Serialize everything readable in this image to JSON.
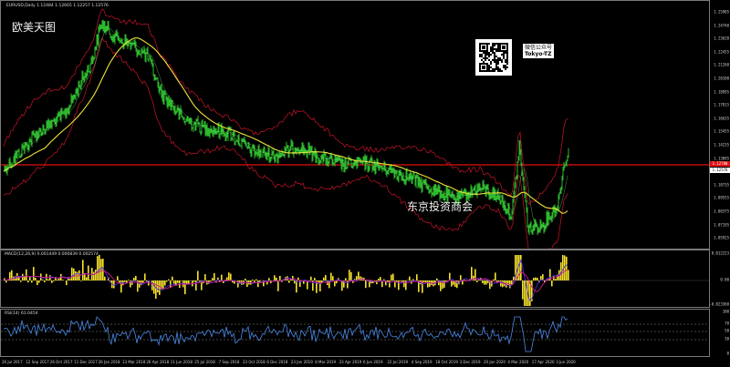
{
  "colors": {
    "background": "#000000",
    "price": "#2eb82e",
    "ma_yellow": "#f0e23a",
    "band_red": "#c8142a",
    "hline": "#e01010",
    "macd_hist": "#f7e22a",
    "macd_line1": "#4a2ad8",
    "macd_line2": "#d01a8a",
    "rsi": "#4a8be8",
    "grid": "#444444"
  },
  "header": {
    "symbol_info": "EURUSD,Daily  1.12484 1.12665 1.12257 1.12576"
  },
  "watermarks": {
    "top_left": "欧美天图",
    "center": "东京投资商会",
    "qr_caption_line1": "微信公众号",
    "qr_caption_line2": "Tokyo-TZ"
  },
  "price_axis": {
    "ticks": [
      "1.25905",
      "1.24740",
      "1.23620",
      "1.22455",
      "1.21260",
      "1.20180",
      "1.18995",
      "1.17815",
      "1.16635",
      "1.15455",
      "1.14235",
      "1.13095",
      "1.11915",
      "1.10735",
      "1.09555",
      "1.08375",
      "1.07195",
      "1.05925"
    ],
    "current_price": "1.12576",
    "hline_price": "1.12780"
  },
  "macd": {
    "label": "MACD(12,26,9) 0.001449 0.000839 0.002574",
    "ticks": [
      "0.012223",
      "0.00",
      "-0.023360"
    ]
  },
  "rsi": {
    "label": "RSI(14) 61.0454",
    "ticks": [
      "100",
      "70",
      "50",
      "30",
      "0"
    ]
  },
  "time_axis": {
    "labels": [
      "26 Jul 2017",
      "12 Sep 2017",
      "26 Oct 2017",
      "11 Dec 2017",
      "26 Jan 2018",
      "13 Mar 2018",
      "26 Apr 2018",
      "11 Jun 2018",
      "25 Jul 2018",
      "7 Sep 2018",
      "23 Oct 2018",
      "6 Dec 2018",
      "23 Jan 2019",
      "8 Mar 2019",
      "23 Apr 2019",
      "6 Jun 2019",
      "22 Jul 2019",
      "4 Sep 2019",
      "18 Oct 2019",
      "3 Dec 2019",
      "20 Jan 2020",
      "4 Mar 2020",
      "17 Apr 2020",
      "3 Jun 2020"
    ]
  }
}
